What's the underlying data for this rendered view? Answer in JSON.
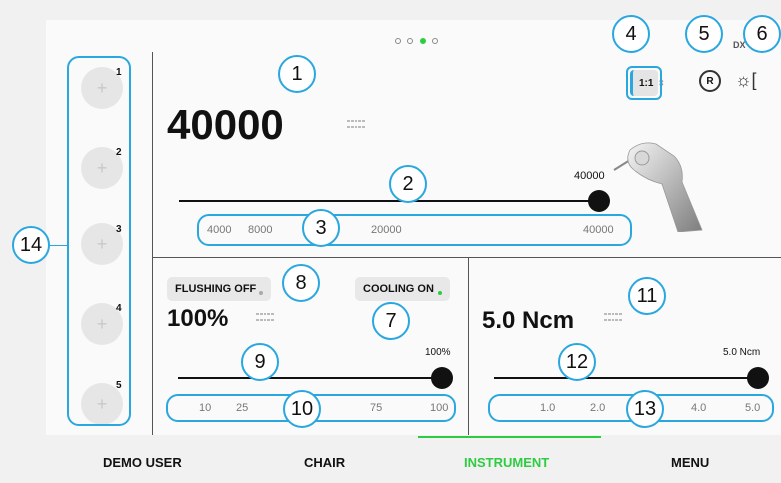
{
  "pager": {
    "count": 4,
    "active_index": 2
  },
  "speed": {
    "value": "40000",
    "max_label": "40000",
    "scale": [
      "4000",
      "8000",
      "20000",
      "40000"
    ],
    "slider_fraction": 1.0
  },
  "flushing": {
    "label": "FLUSHING OFF",
    "value": "100%",
    "max_label": "100%",
    "scale": [
      "10",
      "25",
      "75",
      "100"
    ]
  },
  "cooling": {
    "label": "COOLING ON"
  },
  "torque": {
    "value": "5.0 Ncm",
    "max_label": "5.0 Ncm",
    "scale": [
      "1.0",
      "2.0",
      "4.0",
      "5.0"
    ]
  },
  "header": {
    "ratio_label": "1:1",
    "dx_label": "DX"
  },
  "presets": [
    {
      "num": "1",
      "icon": "+"
    },
    {
      "num": "2",
      "icon": "+"
    },
    {
      "num": "3",
      "icon": "+"
    },
    {
      "num": "4",
      "icon": "+"
    },
    {
      "num": "5",
      "icon": "+"
    }
  ],
  "callouts": [
    "1",
    "2",
    "3",
    "4",
    "5",
    "6",
    "7",
    "8",
    "9",
    "10",
    "11",
    "12",
    "13",
    "14"
  ],
  "nav": {
    "items": [
      "DEMO USER",
      "CHAIR",
      "INSTRUMENT",
      "MENU"
    ],
    "active": "INSTRUMENT"
  },
  "colors": {
    "accent": "#2aa7df",
    "active_green": "#2ecc40"
  },
  "icons": [
    "rotation-reverse-icon",
    "light-icon",
    "keyboard-icon",
    "plus-icon",
    "handpiece-image"
  ]
}
